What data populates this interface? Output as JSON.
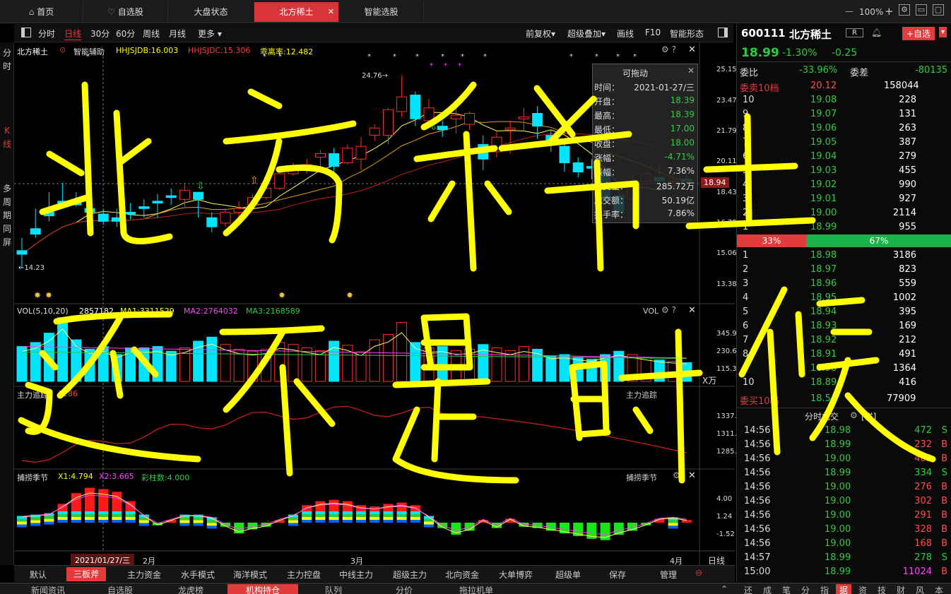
{
  "tabs": [
    {
      "label": "首页",
      "icon": "home-icon"
    },
    {
      "label": "自选股",
      "icon": "heart-icon"
    },
    {
      "label": "大盘状态"
    },
    {
      "label": "北方稀土",
      "active": true
    },
    {
      "label": "智能选股"
    }
  ],
  "zoom": "100%",
  "toolbar": {
    "periods": [
      "分时",
      "日线",
      "30分",
      "60分",
      "周线",
      "月线",
      "更多 ▾"
    ],
    "active_period": "日线",
    "right_items": [
      "前复权▾",
      "超级叠加▾",
      "画线",
      "F10",
      "智能形态"
    ]
  },
  "rail": [
    "分时",
    "K线",
    "多周期同屏"
  ],
  "main_legend": {
    "stock": "北方稀土",
    "indicator": "智能辅助",
    "v1": "HHJSJDB:16.003",
    "v2": "HHJSJDC:15.306",
    "v3": "乖离率:12.482"
  },
  "price_axis": [
    "25.15",
    "23.47",
    "21.79",
    "20.11",
    "18.43",
    "16.75",
    "15.06",
    "13.38"
  ],
  "current_price_tag": "18.94",
  "high_label": "24.76→",
  "low_label": "←14.23",
  "vol_legend": {
    "name": "VOL(5,10,20)",
    "v": "2857182",
    "ma1": "MA1:3311529",
    "ma2": "MA2:2764032",
    "ma3": "MA3:2168589",
    "tag": "VOL"
  },
  "vol_axis": [
    "345.93",
    "230.62",
    "115.31",
    "X万"
  ],
  "main_force_legend": {
    "name": "主力追踪",
    "v": "1286",
    "tag": "主力追踪"
  },
  "main_force_axis": [
    "1337.53",
    "1311.71",
    "1285.89"
  ],
  "season_legend": {
    "name": "捕捞季节",
    "x1": "X1:4.794",
    "x2": "X2:3.665",
    "x3": "彩柱数:4.000",
    "tag": "捕捞季节"
  },
  "season_axis": [
    "4.00",
    "1.24",
    "-1.52"
  ],
  "date_axis": {
    "cursor": "2021/01/27/三",
    "m2": "2月",
    "m3": "3月",
    "m4": "4月",
    "right": "日线"
  },
  "tooltip": {
    "title": "可拖动",
    "rows": [
      {
        "k": "时间：",
        "v": "2021-01-27/三",
        "c": "#dddddd"
      },
      {
        "k": "开盘：",
        "v": "18.39",
        "c": "#2ecc40"
      },
      {
        "k": "最高：",
        "v": "18.39",
        "c": "#2ecc40"
      },
      {
        "k": "最低：",
        "v": "17.00",
        "c": "#2ecc40"
      },
      {
        "k": "收盘：",
        "v": "18.00",
        "c": "#2ecc40"
      },
      {
        "k": "涨幅：",
        "v": "-4.71%",
        "c": "#2ecc40"
      },
      {
        "k": "振幅：",
        "v": "7.36%",
        "c": "#dddddd"
      },
      {
        "k": "成交量：",
        "v": "285.72万",
        "c": "#dddddd"
      },
      {
        "k": "成交额：",
        "v": "50.19亿",
        "c": "#dddddd"
      },
      {
        "k": "换手率：",
        "v": "7.86%",
        "c": "#dddddd"
      }
    ]
  },
  "quote": {
    "code": "600111",
    "name": "北方稀土",
    "badge": "R",
    "add_btn": "+自选",
    "price": "18.99",
    "pct": "-1.30%",
    "chg": "-0.25",
    "wb_label": "委比",
    "wb": "-33.96%",
    "wc_label": "委差",
    "wc": "-80135",
    "sell_label": "委卖10档",
    "sell_price": "20.12",
    "sell_total": "158044",
    "buy_label": "委买10档",
    "buy_price": "18.54",
    "buy_total": "77909",
    "ratio_left": "33%",
    "ratio_right": "67%",
    "asks": [
      {
        "n": "10",
        "p": "19.08",
        "v": "228"
      },
      {
        "n": "9",
        "p": "19.07",
        "v": "131"
      },
      {
        "n": "8",
        "p": "19.06",
        "v": "263"
      },
      {
        "n": "7",
        "p": "19.05",
        "v": "387"
      },
      {
        "n": "6",
        "p": "19.04",
        "v": "279"
      },
      {
        "n": "5",
        "p": "19.03",
        "v": "455"
      },
      {
        "n": "4",
        "p": "19.02",
        "v": "990"
      },
      {
        "n": "3",
        "p": "19.01",
        "v": "927"
      },
      {
        "n": "2",
        "p": "19.00",
        "v": "2114"
      },
      {
        "n": "1",
        "p": "18.99",
        "v": "955"
      }
    ],
    "bids": [
      {
        "n": "1",
        "p": "18.98",
        "v": "3186"
      },
      {
        "n": "2",
        "p": "18.97",
        "v": "823"
      },
      {
        "n": "3",
        "p": "18.96",
        "v": "559"
      },
      {
        "n": "4",
        "p": "18.95",
        "v": "1002"
      },
      {
        "n": "5",
        "p": "18.94",
        "v": "395"
      },
      {
        "n": "6",
        "p": "18.93",
        "v": "169"
      },
      {
        "n": "7",
        "p": "18.92",
        "v": "212"
      },
      {
        "n": "8",
        "p": "18.91",
        "v": "491"
      },
      {
        "n": "9",
        "p": "18.90",
        "v": "1364"
      },
      {
        "n": "10",
        "p": "18.89",
        "v": "416"
      }
    ],
    "ticks_title": "分时成交",
    "ticks_detail": "[详]",
    "ticks": [
      {
        "t": "14:56",
        "p": "18.98",
        "v": "472",
        "s": "S"
      },
      {
        "t": "14:56",
        "p": "18.99",
        "v": "232",
        "s": "B"
      },
      {
        "t": "14:56",
        "p": "19.00",
        "v": "403",
        "s": "B"
      },
      {
        "t": "14:56",
        "p": "18.99",
        "v": "334",
        "s": "S"
      },
      {
        "t": "14:56",
        "p": "19.00",
        "v": "276",
        "s": "B"
      },
      {
        "t": "14:56",
        "p": "19.00",
        "v": "302",
        "s": "B"
      },
      {
        "t": "14:56",
        "p": "19.00",
        "v": "291",
        "s": "B"
      },
      {
        "t": "14:56",
        "p": "19.00",
        "v": "328",
        "s": "B"
      },
      {
        "t": "14:56",
        "p": "19.00",
        "v": "168",
        "s": "B"
      },
      {
        "t": "14:57",
        "p": "18.99",
        "v": "278",
        "s": "S"
      },
      {
        "t": "15:00",
        "p": "18.99",
        "v": "11024",
        "s": "B"
      }
    ]
  },
  "bottom_tabs": [
    "默认",
    "三板斧",
    "主力资金",
    "水手模式",
    "海洋模式",
    "主力控盘",
    "中线主力",
    "超级主力",
    "北向资金",
    "大单博弈",
    "超级单",
    "保存",
    "管理"
  ],
  "bottom_active": "三板斧",
  "bottom2": [
    "新闻资讯",
    "自选股",
    "龙虎榜",
    "机构持仓",
    "队列",
    "分价",
    "拖拉机单"
  ],
  "bottom2_active": "机构持仓",
  "side_tabs": [
    "还",
    "成",
    "笔",
    "分",
    "指",
    "据",
    "资",
    "技",
    "财",
    "风",
    "本"
  ],
  "side_active": "据",
  "overlay_lines": [
    "北方稀土",
    "还不是时候"
  ],
  "colors": {
    "up": "#ff2b2b",
    "down": "#00e5ff",
    "accent": "#e23b3b",
    "green": "#2ecc40",
    "yellow": "#ffff00",
    "overlay": "#ffff00"
  },
  "chart_data": {
    "type": "candlestick",
    "candles": [
      [
        15.2,
        15.9,
        15.0,
        14.23
      ],
      [
        16.4,
        17.5,
        16.1,
        15.9
      ],
      [
        17.3,
        18.4,
        17.1,
        16.8
      ],
      [
        17.9,
        18.9,
        17.8,
        17.6
      ],
      [
        18.0,
        18.4,
        17.7,
        17.6
      ],
      [
        17.5,
        17.9,
        17.3,
        17.0
      ],
      [
        17.2,
        17.5,
        16.8,
        16.6
      ],
      [
        17.0,
        17.5,
        16.8,
        16.5
      ],
      [
        17.3,
        17.8,
        17.2,
        16.9
      ],
      [
        17.6,
        18.0,
        17.5,
        17.0
      ],
      [
        17.9,
        18.3,
        17.8,
        17.0
      ],
      [
        18.2,
        18.6,
        18.1,
        17.7
      ],
      [
        18.0,
        18.9,
        18.5,
        17.6
      ],
      [
        18.39,
        18.39,
        18.0,
        17.0
      ],
      [
        17.0,
        17.3,
        16.5,
        16.2
      ],
      [
        16.7,
        17.5,
        17.3,
        16.5
      ],
      [
        17.3,
        17.9,
        17.5,
        17.0
      ],
      [
        17.7,
        18.3,
        18.1,
        17.5
      ],
      [
        18.1,
        18.7,
        18.6,
        18.0
      ],
      [
        18.6,
        19.5,
        19.4,
        18.5
      ],
      [
        19.4,
        20.0,
        19.6,
        19.3
      ],
      [
        19.7,
        20.2,
        19.9,
        19.4
      ],
      [
        20.3,
        20.7,
        20.5,
        19.8
      ],
      [
        20.5,
        20.8,
        19.8,
        19.5
      ],
      [
        20.0,
        21.0,
        20.8,
        19.9
      ],
      [
        20.2,
        21.4,
        20.9,
        19.6
      ],
      [
        21.5,
        22.1,
        21.9,
        21.2
      ],
      [
        21.5,
        23.0,
        22.9,
        21.0
      ],
      [
        22.8,
        24.76,
        23.6,
        22.5
      ],
      [
        23.7,
        23.9,
        22.4,
        22.0
      ],
      [
        22.3,
        23.5,
        23.0,
        22.1
      ],
      [
        22.0,
        22.3,
        21.8,
        21.4
      ],
      [
        22.4,
        23.0,
        22.6,
        21.6
      ],
      [
        22.1,
        22.8,
        22.7,
        21.8
      ],
      [
        21.0,
        21.5,
        20.2,
        19.6
      ],
      [
        20.6,
        21.8,
        21.4,
        20.3
      ],
      [
        21.8,
        22.3,
        21.9,
        20.5
      ],
      [
        22.4,
        23.0,
        22.5,
        21.7
      ],
      [
        22.7,
        23.1,
        22.0,
        21.3
      ],
      [
        21.5,
        21.8,
        21.2,
        20.6
      ],
      [
        20.9,
        21.2,
        20.0,
        19.5
      ],
      [
        20.0,
        20.3,
        19.5,
        19.2
      ],
      [
        19.8,
        20.2,
        19.7,
        19.1
      ],
      [
        19.5,
        19.9,
        17.9,
        17.6
      ],
      [
        18.2,
        18.6,
        17.3,
        17.2
      ],
      [
        18.0,
        19.4,
        18.9,
        17.9
      ],
      [
        19.0,
        19.6,
        19.4,
        18.8
      ],
      [
        19.2,
        19.9,
        19.0,
        18.7
      ],
      [
        19.0,
        19.4,
        19.0,
        18.9
      ],
      [
        19.1,
        19.5,
        18.99,
        18.9
      ]
    ]
  }
}
